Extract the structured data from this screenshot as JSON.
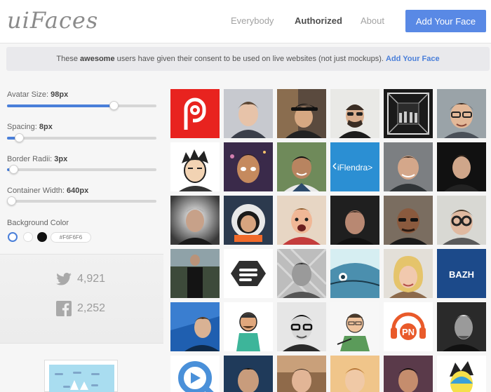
{
  "header": {
    "logo": "uiFaces",
    "nav": [
      "Everybody",
      "Authorized",
      "About"
    ],
    "active_nav": "Authorized",
    "cta": "Add Your Face"
  },
  "notice": {
    "prefix": "These ",
    "bold": "awesome",
    "middle": " users have given their consent to be used on live websites (not just mockups). ",
    "link": "Add Your Face"
  },
  "controls": {
    "avatar_size": {
      "label": "Avatar Size:",
      "value": "98px",
      "fraction": 0.71
    },
    "spacing": {
      "label": "Spacing:",
      "value": "8px",
      "fraction": 0.08
    },
    "border_radii": {
      "label": "Border Radii:",
      "value": "3px",
      "fraction": 0.04
    },
    "container_width": {
      "label": "Container Width:",
      "value": "640px",
      "fraction": 0.03
    },
    "background_color": {
      "label": "Background Color",
      "value": "#F6F6F6",
      "swatches": [
        "#FFFFFF",
        "#FFFFFF",
        "#111111"
      ]
    }
  },
  "social": {
    "twitter_count": "4,921",
    "facebook_count": "2,252"
  },
  "grid_text": {
    "iflendra": "iFlendra>",
    "bazh": "BAZH"
  },
  "colors": {
    "accent": "#5989E5",
    "link": "#4A7FD9",
    "page_bg": "#F6F6F6"
  }
}
